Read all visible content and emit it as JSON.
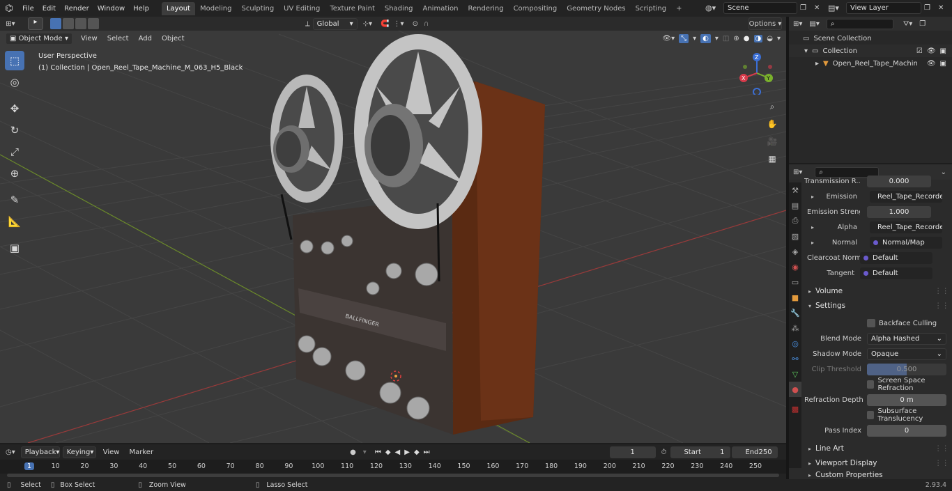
{
  "topbar": {
    "menus": [
      "File",
      "Edit",
      "Render",
      "Window",
      "Help"
    ],
    "workspaces": [
      "Layout",
      "Modeling",
      "Sculpting",
      "UV Editing",
      "Texture Paint",
      "Shading",
      "Animation",
      "Rendering",
      "Compositing",
      "Geometry Nodes",
      "Scripting"
    ],
    "active_workspace": "Layout",
    "scene": "Scene",
    "view_layer": "View Layer"
  },
  "viewport_header": {
    "mode": "Object Mode",
    "menus": [
      "View",
      "Select",
      "Add",
      "Object"
    ],
    "transform_orientation": "Global",
    "options_label": "Options"
  },
  "viewport": {
    "perspective_label": "User Perspective",
    "collection_label": "(1) Collection | Open_Reel_Tape_Machine_M_063_H5_Black",
    "gizmo_axes": [
      "X",
      "Y",
      "Z"
    ],
    "brand_text": "BALLFINGER"
  },
  "outliner": {
    "scene_collection": "Scene Collection",
    "collection": "Collection",
    "object": "Open_Reel_Tape_Machin"
  },
  "properties": {
    "rows": [
      {
        "label": "Transmission R...",
        "value": "0.000"
      },
      {
        "label": "Emission",
        "value": "Reel_Tape_Recorder..."
      },
      {
        "label": "Emission Strengt",
        "value": "1.000"
      },
      {
        "label": "Alpha",
        "value": "Reel_Tape_Recorder..."
      },
      {
        "label": "Normal",
        "value": "Normal/Map"
      },
      {
        "label": "Clearcoat Normal",
        "value": "Default"
      },
      {
        "label": "Tangent",
        "value": "Default"
      }
    ],
    "volume_label": "Volume",
    "settings_label": "Settings",
    "backface_culling": "Backface Culling",
    "blend_mode_label": "Blend Mode",
    "blend_mode": "Alpha Hashed",
    "shadow_mode_label": "Shadow Mode",
    "shadow_mode": "Opaque",
    "clip_threshold_label": "Clip Threshold",
    "clip_threshold": "0.500",
    "screen_space_refraction": "Screen Space Refraction",
    "refraction_depth_label": "Refraction Depth",
    "refraction_depth": "0 m",
    "subsurface_translucency": "Subsurface Translucency",
    "pass_index_label": "Pass Index",
    "pass_index": "0",
    "line_art": "Line Art",
    "viewport_display": "Viewport Display",
    "custom_properties": "Custom Properties"
  },
  "timeline": {
    "menus": [
      "Playback",
      "Keying",
      "View",
      "Marker"
    ],
    "current_frame": "1",
    "start_label": "Start",
    "start": "1",
    "end_label": "End",
    "end": "250",
    "ruler": [
      "1",
      "10",
      "20",
      "30",
      "40",
      "50",
      "60",
      "70",
      "80",
      "90",
      "100",
      "110",
      "120",
      "130",
      "140",
      "150",
      "160",
      "170",
      "180",
      "190",
      "200",
      "210",
      "220",
      "230",
      "240",
      "250"
    ]
  },
  "statusbar": {
    "select": "Select",
    "box_select": "Box Select",
    "zoom_view": "Zoom View",
    "lasso_select": "Lasso Select",
    "version": "2.93.4"
  }
}
